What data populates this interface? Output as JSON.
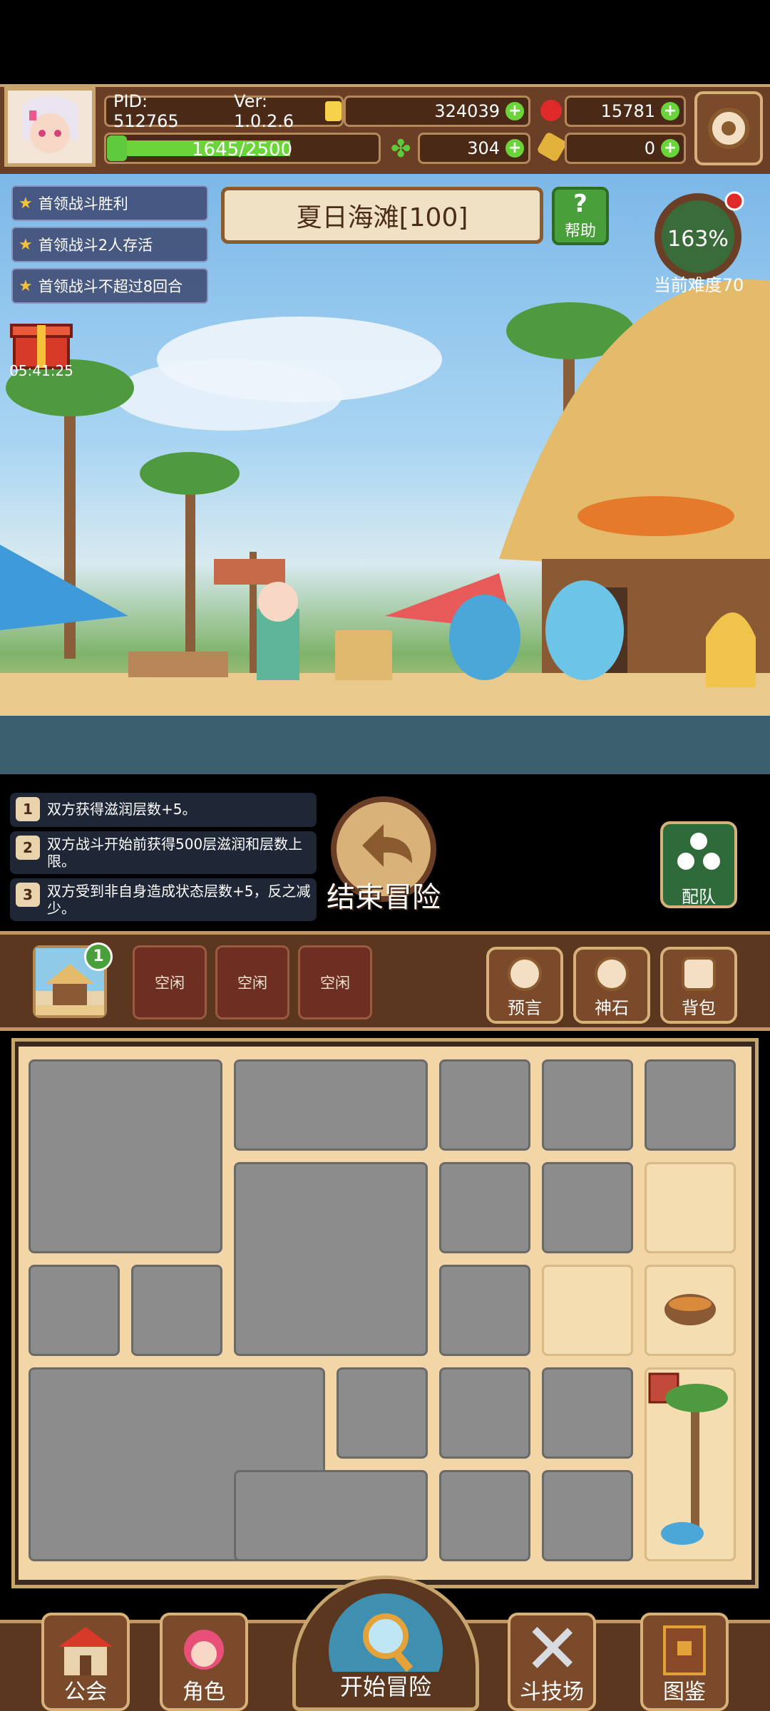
{
  "header": {
    "pid": "PID: 512765",
    "version": "Ver: 1.0.2.6",
    "gold": "324039",
    "gems": "15781",
    "exp": "1645/2500",
    "clover": "304",
    "keys": "0"
  },
  "quests": [
    "首领战斗胜利",
    "首领战斗2人存活",
    "首领战斗不超过8回合"
  ],
  "timer": "05:41:25",
  "stage": {
    "title": "夏日海滩[100]",
    "help": "帮助",
    "difficulty_pct": "163%",
    "difficulty_label": "当前难度70"
  },
  "effects": [
    {
      "num": "1",
      "text": "双方获得滋润层数+5。"
    },
    {
      "num": "2",
      "text": "双方战斗开始前获得500层滋润和层数上限。"
    },
    {
      "num": "3",
      "text": "双方受到非自身造成状态层数+5，反之减少。"
    }
  ],
  "actions": {
    "end": "结束冒险",
    "team": "配队"
  },
  "slots": {
    "badge": "1",
    "items": [
      "空闲",
      "空闲",
      "空闲"
    ]
  },
  "side_buttons": [
    "预言",
    "神石",
    "背包"
  ],
  "nav": [
    "公会",
    "角色",
    "开始冒险",
    "斗技场",
    "图鉴"
  ],
  "colors": {
    "accent_green": "#6bd43a",
    "panel_brown": "#5b3720",
    "gold_border": "#c9a56e"
  }
}
